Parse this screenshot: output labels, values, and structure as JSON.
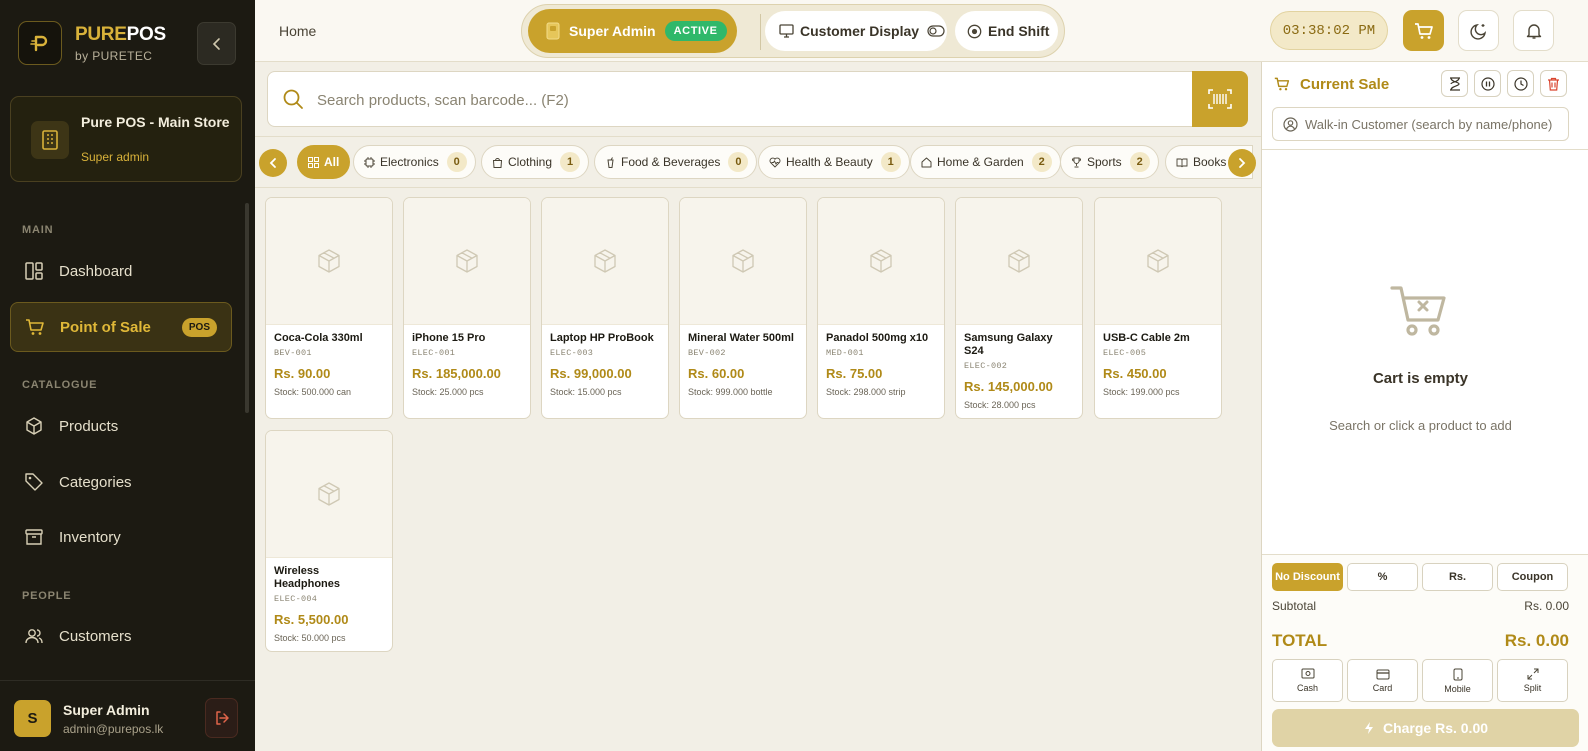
{
  "brand": {
    "name_part1": "PURE",
    "name_part2": "POS",
    "subtitle": "by PURETEC"
  },
  "store": {
    "name": "Pure POS - Main Store",
    "role": "Super admin"
  },
  "sidebar": {
    "sections": {
      "main": "MAIN",
      "catalogue": "CATALOGUE",
      "people": "PEOPLE"
    },
    "items": [
      {
        "label": "Dashboard",
        "icon": "dashboard-icon"
      },
      {
        "label": "Point of Sale",
        "icon": "cart-icon",
        "badge": "POS",
        "active": true
      },
      {
        "label": "Products",
        "icon": "box-icon"
      },
      {
        "label": "Categories",
        "icon": "tag-icon"
      },
      {
        "label": "Inventory",
        "icon": "archive-icon"
      },
      {
        "label": "Customers",
        "icon": "users-icon"
      }
    ]
  },
  "user": {
    "initial": "S",
    "name": "Super Admin",
    "email": "admin@purepos.lk"
  },
  "topbar": {
    "breadcrumb": "Home",
    "role_label": "Super Admin",
    "role_status": "ACTIVE",
    "customer_display_label": "Customer Display",
    "end_shift_label": "End Shift",
    "clock": "03:38:02 PM"
  },
  "search": {
    "placeholder": "Search products, scan barcode... (F2)"
  },
  "categories": [
    {
      "label": "All",
      "active": true
    },
    {
      "label": "Electronics",
      "count": "0"
    },
    {
      "label": "Clothing",
      "count": "1"
    },
    {
      "label": "Food & Beverages",
      "count": "0"
    },
    {
      "label": "Health & Beauty",
      "count": "1"
    },
    {
      "label": "Home & Garden",
      "count": "2"
    },
    {
      "label": "Sports",
      "count": "2"
    },
    {
      "label": "Books"
    }
  ],
  "products": [
    {
      "name": "Coca-Cola 330ml",
      "sku": "BEV-001",
      "price": "Rs. 90.00",
      "stock": "Stock: 500.000 can"
    },
    {
      "name": "iPhone 15 Pro",
      "sku": "ELEC-001",
      "price": "Rs. 185,000.00",
      "stock": "Stock: 25.000 pcs"
    },
    {
      "name": "Laptop HP ProBook",
      "sku": "ELEC-003",
      "price": "Rs. 99,000.00",
      "stock": "Stock: 15.000 pcs"
    },
    {
      "name": "Mineral Water 500ml",
      "sku": "BEV-002",
      "price": "Rs. 60.00",
      "stock": "Stock: 999.000 bottle"
    },
    {
      "name": "Panadol 500mg x10",
      "sku": "MED-001",
      "price": "Rs. 75.00",
      "stock": "Stock: 298.000 strip"
    },
    {
      "name": "Samsung Galaxy S24",
      "sku": "ELEC-002",
      "price": "Rs. 145,000.00",
      "stock": "Stock: 28.000 pcs"
    },
    {
      "name": "USB-C Cable 2m",
      "sku": "ELEC-005",
      "price": "Rs. 450.00",
      "stock": "Stock: 199.000 pcs"
    },
    {
      "name": "Wireless Headphones",
      "sku": "ELEC-004",
      "price": "Rs. 5,500.00",
      "stock": "Stock: 50.000 pcs"
    }
  ],
  "cart": {
    "title": "Current Sale",
    "customer_placeholder": "Walk-in Customer (search by name/phone)",
    "empty_title": "Cart is empty",
    "empty_subtitle": "Search or click a product to add",
    "discounts": [
      "No Discount",
      "%",
      "Rs.",
      "Coupon"
    ],
    "subtotal_label": "Subtotal",
    "subtotal_value": "Rs. 0.00",
    "total_label": "TOTAL",
    "total_value": "Rs. 0.00",
    "payments": [
      "Cash",
      "Card",
      "Mobile",
      "Split"
    ],
    "charge_label": "Charge Rs. 0.00"
  },
  "colors": {
    "accent": "#c9a22c",
    "sidebar_bg": "#1c1a12",
    "page_bg": "#f2efe6",
    "success": "#2fb86a"
  }
}
